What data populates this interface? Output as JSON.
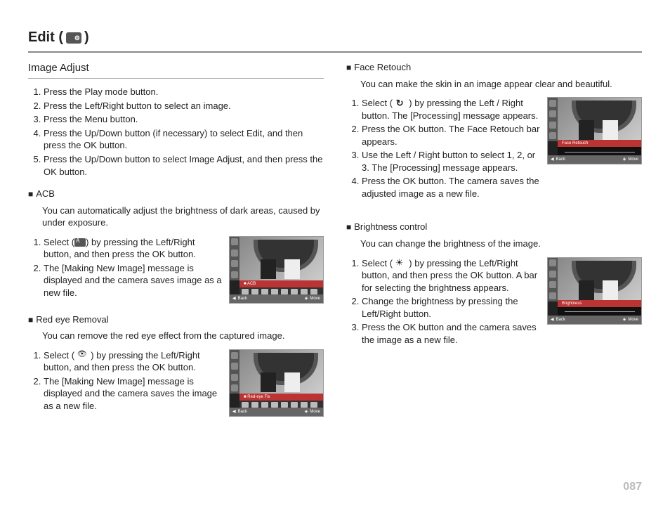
{
  "page": {
    "title_prefix": "Edit ( ",
    "title_suffix": " )",
    "number": "087"
  },
  "left": {
    "subtitle": "Image Adjust",
    "intro_steps": [
      "Press the Play mode button.",
      "Press the Left/Right button to select an image.",
      "Press the Menu button.",
      "Press the Up/Down button (if necessary) to select Edit, and then press the OK button.",
      "Press the Up/Down button to select Image Adjust, and then press the OK button."
    ],
    "acb": {
      "heading": "ACB",
      "desc": "You can automatically adjust the brightness of dark areas, caused by under exposure.",
      "steps_a": "Select (",
      "steps_a2": ") by pressing the Left/Right button, and then press the OK button.",
      "steps_b": "The [Making New Image] message is displayed and the camera saves image as a new file.",
      "screen_label": "ACB",
      "screen_back": "Back",
      "screen_move": "Move"
    },
    "redeye": {
      "heading": "Red eye Removal",
      "desc": "You can remove the red eye effect from the captured image.",
      "steps_a": "Select ( ",
      "steps_a2": " ) by pressing the Left/Right button, and then press the OK button.",
      "steps_b": "The [Making New Image] message is displayed and the camera saves the image as a new file.",
      "screen_label": "Red-eye Fix",
      "screen_back": "Back",
      "screen_move": "Move"
    }
  },
  "right": {
    "face": {
      "heading": "Face Retouch",
      "desc": "You can make the skin in an image appear clear and beautiful.",
      "steps_a": "Select ( ",
      "steps_a2": " ) by pressing the Left / Right button. The [Processing] message appears.",
      "steps_b": "Press the OK button. The Face Retouch bar appears.",
      "steps_c": "Use the Left / Right button to select 1, 2, or 3.  The [Processing] message appears.",
      "steps_d": "Press the OK button. The camera saves the adjusted image as a new file.",
      "screen_label": "Face Retouch",
      "screen_back": "Back",
      "screen_move": "Move"
    },
    "bright": {
      "heading": "Brightness control",
      "desc": "You can change the brightness of the image.",
      "steps_a": "Select ( ",
      "steps_a2": " ) by pressing the Left/Right button, and then press the OK button. A bar for selecting the brightness appears.",
      "steps_b": "Change the brightness by pressing the Left/Right button.",
      "steps_c": "Press the OK button and the camera saves the image as a new file.",
      "screen_label": "Brightness",
      "screen_back": "Back",
      "screen_move": "Move"
    }
  }
}
